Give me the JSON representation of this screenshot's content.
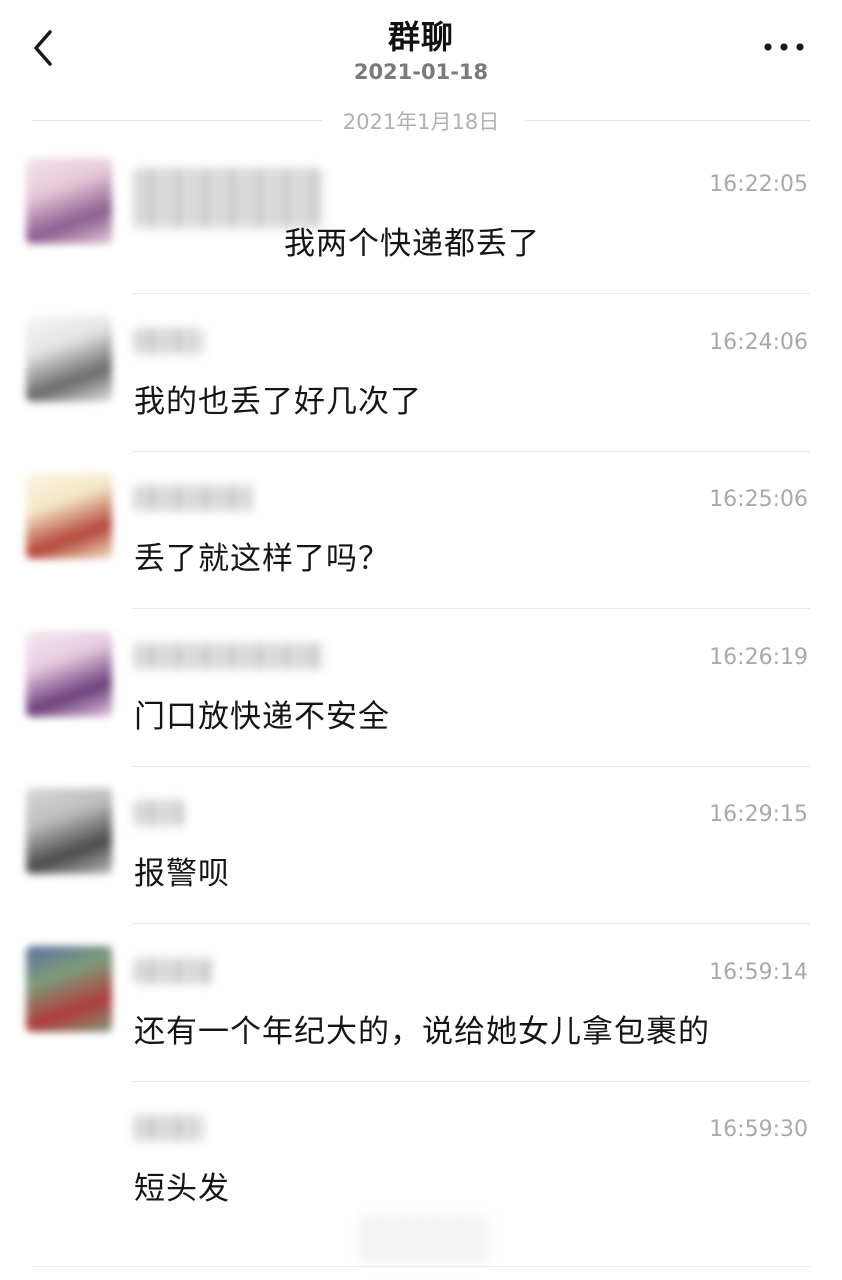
{
  "header": {
    "title": "群聊",
    "subtitle": "2021-01-18"
  },
  "date_divider": "2021年1月18日",
  "messages": [
    {
      "time": "16:22:05",
      "text": "我两个快递都丢了",
      "avatar_colors": [
        "#e7c9d8",
        "#8b5d90",
        "#f2e3ea"
      ]
    },
    {
      "time": "16:24:06",
      "text": "我的也丢了好几次了",
      "avatar_colors": [
        "#e4e4e4",
        "#6a6a6a",
        "#f6f6f6"
      ]
    },
    {
      "time": "16:25:06",
      "text": "丢了就这样了吗？",
      "avatar_colors": [
        "#f3e8c6",
        "#b5453a",
        "#fbf5e3"
      ]
    },
    {
      "time": "16:26:19",
      "text": "门口放快递不安全",
      "avatar_colors": [
        "#e8cbe0",
        "#6b3f7c",
        "#f5e8f0"
      ]
    },
    {
      "time": "16:29:15",
      "text": "报警呗",
      "avatar_colors": [
        "#bdbdbd",
        "#4a4a4a",
        "#d8d8d8"
      ]
    },
    {
      "time": "16:59:14",
      "text": "还有一个年纪大的，说给她女儿拿包裹的",
      "avatar_colors": [
        "#7d9c7a",
        "#b03b3b",
        "#5b6fa0"
      ]
    },
    {
      "time": "16:59:30",
      "text": "短头发",
      "avatar_colors": []
    }
  ]
}
